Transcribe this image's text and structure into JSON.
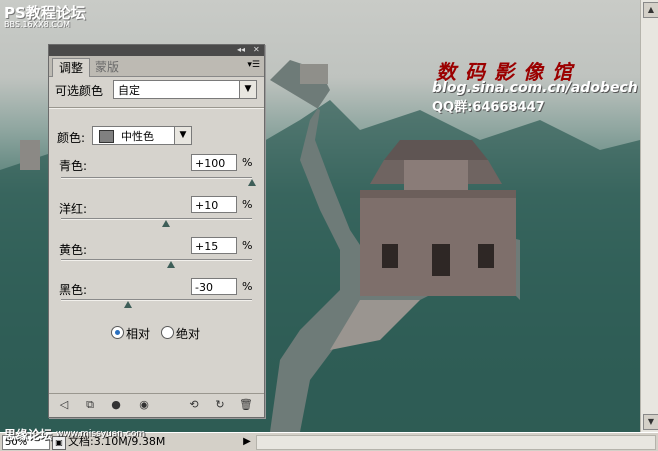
{
  "watermarks": {
    "top_title": "PS教程论坛",
    "top_sub": "BBS.16XX8.COM",
    "bottom_title": "思缘论坛",
    "bottom_url": "www.missyuan.com",
    "title": "数码影像馆",
    "blog": "blog.sina.com.cn/adobech",
    "qq": "QQ群:64668447"
  },
  "panel": {
    "tabs": [
      {
        "label": "调整"
      },
      {
        "label": "蒙版"
      }
    ],
    "preset_label": "可选颜色",
    "preset_value": "自定",
    "color_label": "颜色:",
    "color_value": "中性色",
    "sliders": [
      {
        "label": "青色:",
        "value": "+100",
        "unit": "%",
        "level": 1.0
      },
      {
        "label": "洋红:",
        "value": "+10",
        "unit": "%",
        "level": 0.55
      },
      {
        "label": "黄色:",
        "value": "+15",
        "unit": "%",
        "level": 0.575
      },
      {
        "label": "黑色:",
        "value": "-30",
        "unit": "%",
        "level": 0.35
      }
    ],
    "method": {
      "relative": "相对",
      "absolute": "绝对",
      "selected": "relative"
    },
    "footer_icons": [
      "back-icon",
      "clip-icon",
      "visibility-mask-icon",
      "eye-icon",
      "previous-state-icon",
      "reset-icon",
      "trash-icon"
    ]
  },
  "status": {
    "zoom": "50%",
    "doc": "文档:3.10M/9.38M"
  }
}
